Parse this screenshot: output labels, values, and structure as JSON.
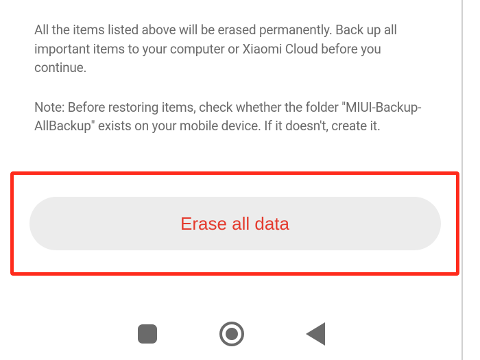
{
  "warning": "All the items listed above will be erased permanently. Back up all important items to your computer or Xiaomi Cloud before you continue.",
  "note": "Note: Before restoring items, check whether the folder \"MIUI-Backup-AllBackup\" exists on your mobile device. If it doesn't, create it.",
  "button": {
    "erase_label": "Erase all data"
  },
  "colors": {
    "highlight_border": "#ff2b1c",
    "button_bg": "#ececec",
    "button_text": "#e43b2e",
    "body_text": "#6a6a6a"
  }
}
